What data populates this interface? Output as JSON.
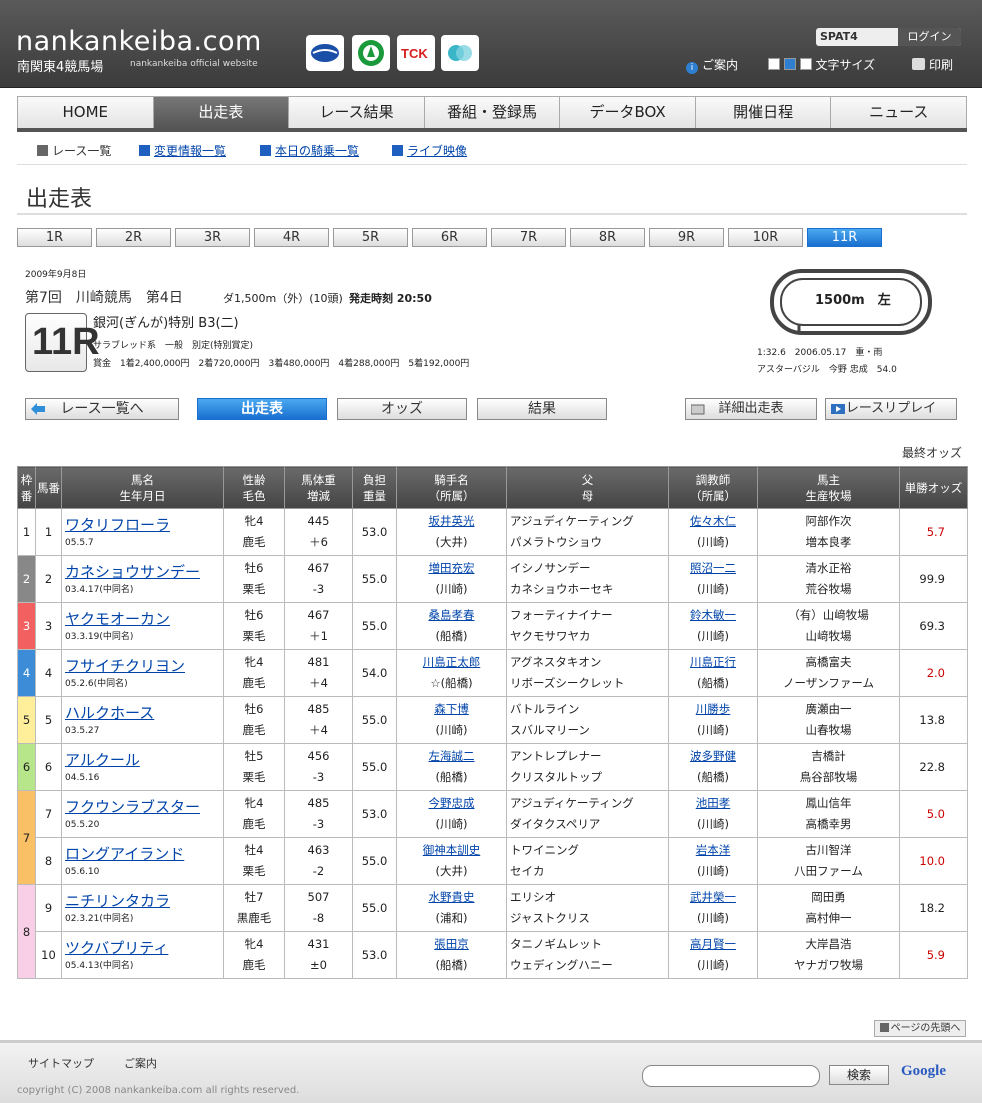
{
  "header": {
    "logo": "nankankeiba.com",
    "subtitle": "南関東4競馬場",
    "subtitle_en": "nankankeiba official website",
    "spat4": "SPAT4",
    "login": "ログイン",
    "guide": "ご案内",
    "font_size": "文字サイズ",
    "print": "印刷"
  },
  "gnav": [
    "HOME",
    "出走表",
    "レース結果",
    "番組・登録馬",
    "データBOX",
    "開催日程",
    "ニュース"
  ],
  "subnav": [
    "レース一覧",
    "変更情報一覧",
    "本日の騎乗一覧",
    "ライブ映像"
  ],
  "page_title": "出走表",
  "race_tabs": [
    "1R",
    "2R",
    "3R",
    "4R",
    "5R",
    "6R",
    "7R",
    "8R",
    "9R",
    "10R",
    "11R"
  ],
  "race": {
    "date": "2009年9月8日",
    "meeting": "第7回　川崎競馬　第4日",
    "distance": "ダ1,500m（外）(10頭)",
    "start_time": "発走時刻 20:50",
    "race_no": "11R",
    "name": "銀河(ぎんが)特別 B3(二)",
    "conditions": "サラブレッド系　一般　別定(特別賞定)",
    "prize": "賞金　1着2,400,000円　2着720,000円　3着480,000円　4着288,000円　5着192,000円",
    "course_label": "1500m　左",
    "record": "1:32.6　2006.05.17　重・雨",
    "record_holder": "アスターバジル　今野 忠成　54.0"
  },
  "actions": {
    "back": "レース一覧へ",
    "entries": "出走表",
    "odds": "オッズ",
    "result": "結果",
    "detail": "詳細出走表",
    "replay": "レースリプレイ"
  },
  "final_odds": "最終オッズ",
  "table": {
    "headers": {
      "waku": "枠番",
      "uma": "馬番",
      "horse": "馬名",
      "horse2": "生年月日",
      "sex": "性齢",
      "sex2": "毛色",
      "weight": "馬体重",
      "weight2": "増減",
      "burden": "負担",
      "burden2": "重量",
      "jockey": "騎手名",
      "jockey2": "（所属）",
      "sire": "父",
      "sire2": "母",
      "trainer": "調教師",
      "trainer2": "（所属）",
      "owner": "馬主",
      "owner2": "生産牧場",
      "odds": "単勝オッズ"
    },
    "rows": [
      {
        "waku": "1",
        "uma": "1",
        "horse": "ワタリフローラ",
        "birth": "05.5.7",
        "sex": "牝4",
        "color": "鹿毛",
        "weight": "445",
        "diff": "＋6",
        "burden": "53.0",
        "jockey": "坂井英光",
        "jaff": "(大井)",
        "sire": "アジュディケーティング",
        "dam": "パメラトウショウ",
        "trainer": "佐々木仁",
        "taff": "(川崎)",
        "owner": "阿部作次",
        "breeder": "増本良孝",
        "odds": "5.7"
      },
      {
        "waku": "2",
        "uma": "2",
        "horse": "カネショウサンデー",
        "birth": "03.4.17(中同名)",
        "sex": "牡6",
        "color": "栗毛",
        "weight": "467",
        "diff": "-3",
        "burden": "55.0",
        "jockey": "増田充宏",
        "jaff": "(川崎)",
        "sire": "イシノサンデー",
        "dam": "カネショウホーセキ",
        "trainer": "照沼一二",
        "taff": "(川崎)",
        "owner": "清水正裕",
        "breeder": "荒谷牧場",
        "odds": "99.9"
      },
      {
        "waku": "3",
        "uma": "3",
        "horse": "ヤクモオーカン",
        "birth": "03.3.19(中同名)",
        "sex": "牡6",
        "color": "栗毛",
        "weight": "467",
        "diff": "＋1",
        "burden": "55.0",
        "jockey": "桑島孝春",
        "jaff": "(船橋)",
        "sire": "フォーティナイナー",
        "dam": "ヤクモサワヤカ",
        "trainer": "鈴木敏一",
        "taff": "(川崎)",
        "owner": "（有）山﨑牧場",
        "breeder": "山﨑牧場",
        "odds": "69.3"
      },
      {
        "waku": "4",
        "uma": "4",
        "horse": "フサイチクリヨン",
        "birth": "05.2.6(中同名)",
        "sex": "牝4",
        "color": "鹿毛",
        "weight": "481",
        "diff": "＋4",
        "burden": "54.0",
        "jockey": "川島正太郎",
        "jaff": "☆(船橋)",
        "sire": "アグネスタキオン",
        "dam": "リボーズシークレット",
        "trainer": "川島正行",
        "taff": "(船橋)",
        "owner": "高橋富夫",
        "breeder": "ノーザンファーム",
        "odds": "2.0"
      },
      {
        "waku": "5",
        "uma": "5",
        "horse": "ハルクホース",
        "birth": "03.5.27",
        "sex": "牡6",
        "color": "鹿毛",
        "weight": "485",
        "diff": "＋4",
        "burden": "55.0",
        "jockey": "森下博",
        "jaff": "(川崎)",
        "sire": "バトルライン",
        "dam": "スバルマリーン",
        "trainer": "川勝歩",
        "taff": "(川崎)",
        "owner": "廣瀬由一",
        "breeder": "山春牧場",
        "odds": "13.8"
      },
      {
        "waku": "6",
        "uma": "6",
        "horse": "アルクール",
        "birth": "04.5.16",
        "sex": "牡5",
        "color": "栗毛",
        "weight": "456",
        "diff": "-3",
        "burden": "55.0",
        "jockey": "左海誠二",
        "jaff": "(船橋)",
        "sire": "アントレプレナー",
        "dam": "クリスタルトップ",
        "trainer": "波多野健",
        "taff": "(船橋)",
        "owner": "吉橋計",
        "breeder": "鳥谷部牧場",
        "odds": "22.8"
      },
      {
        "waku": "7",
        "uma": "7",
        "horse": "フクウンラブスター",
        "birth": "05.5.20",
        "sex": "牝4",
        "color": "鹿毛",
        "weight": "485",
        "diff": "-3",
        "burden": "53.0",
        "jockey": "今野忠成",
        "jaff": "(川崎)",
        "sire": "アジュディケーティング",
        "dam": "ダイタクスペリア",
        "trainer": "池田孝",
        "taff": "(川崎)",
        "owner": "鳳山信年",
        "breeder": "高橋幸男",
        "odds": "5.0"
      },
      {
        "waku": "",
        "uma": "8",
        "horse": "ロングアイランド",
        "birth": "05.6.10",
        "sex": "牡4",
        "color": "栗毛",
        "weight": "463",
        "diff": "-2",
        "burden": "55.0",
        "jockey": "御神本訓史",
        "jaff": "(大井)",
        "sire": "トワイニング",
        "dam": "セイカ",
        "trainer": "岩本洋",
        "taff": "(川崎)",
        "owner": "古川智洋",
        "breeder": "八田ファーム",
        "odds": "10.0"
      },
      {
        "waku": "8",
        "uma": "9",
        "horse": "ニチリンタカラ",
        "birth": "02.3.21(中同名)",
        "sex": "牡7",
        "color": "黒鹿毛",
        "weight": "507",
        "diff": "-8",
        "burden": "55.0",
        "jockey": "水野貴史",
        "jaff": "(浦和)",
        "sire": "エリシオ",
        "dam": "ジャストクリス",
        "trainer": "武井榮一",
        "taff": "(川崎)",
        "owner": "岡田勇",
        "breeder": "高村伸一",
        "odds": "18.2"
      },
      {
        "waku": "",
        "uma": "10",
        "horse": "ツクバプリティ",
        "birth": "05.4.13(中同名)",
        "sex": "牝4",
        "color": "鹿毛",
        "weight": "431",
        "diff": "±0",
        "burden": "53.0",
        "jockey": "張田京",
        "jaff": "(船橋)",
        "sire": "タニノギムレット",
        "dam": "ウェディングハニー",
        "trainer": "高月賢一",
        "taff": "(川崎)",
        "owner": "大岸昌浩",
        "breeder": "ヤナガワ牧場",
        "odds": "5.9"
      }
    ]
  },
  "waku_colors": {
    "1": "#ffffff",
    "2": "#888888",
    "3": "#f36060",
    "4": "#3c8cd8",
    "5": "#ffef9a",
    "6": "#b7e58a",
    "7": "#f9c066",
    "8": "#f8cfe6"
  },
  "footer": {
    "pagetop": "ページの先頭へ",
    "sitemap": "サイトマップ",
    "guide": "ご案内",
    "copyright": "copyright (C) 2008 nankankeiba.com all rights reserved.",
    "search_button": "検索",
    "google": "Google"
  }
}
